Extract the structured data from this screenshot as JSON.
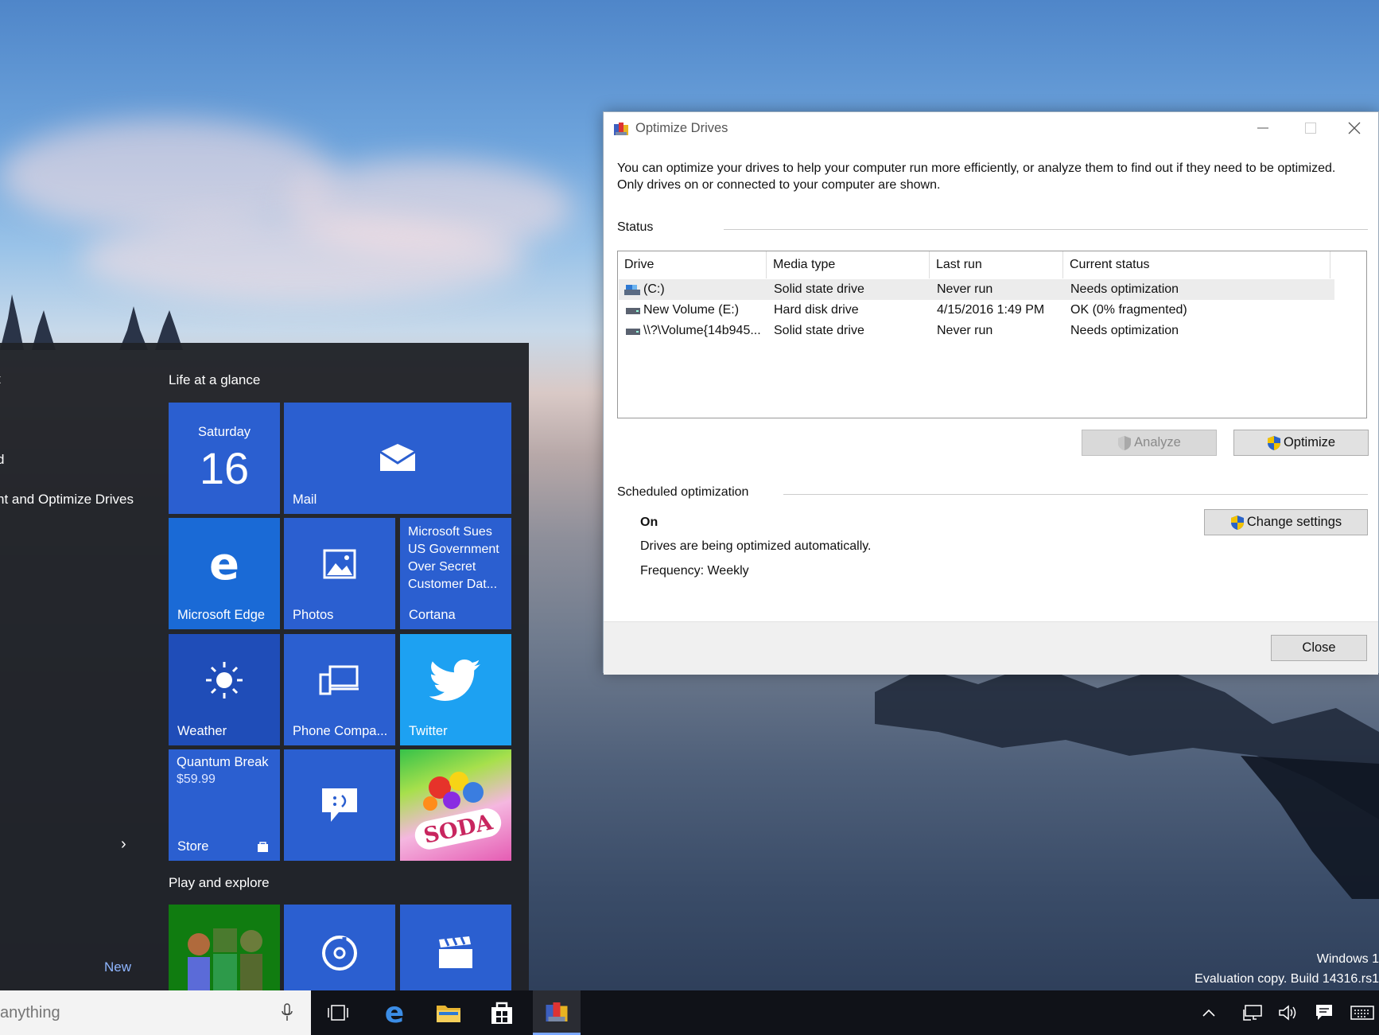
{
  "desktop": {
    "watermark_line1": "Windows 1",
    "watermark_line2": "Evaluation copy. Build 14316.rs1"
  },
  "start_menu": {
    "left_items": [
      "t",
      "d",
      "nt and Optimize Drives"
    ],
    "expand_label": "›",
    "new_label": "New",
    "group1_title": "Life at a glance",
    "group2_title": "Play and explore",
    "tiles": {
      "calendar_day": "Saturday",
      "calendar_date": "16",
      "mail": "Mail",
      "edge": "Microsoft Edge",
      "photos": "Photos",
      "cortana_news": "Microsoft Sues US Government Over Secret Customer Dat...",
      "cortana": "Cortana",
      "weather": "Weather",
      "phone": "Phone Compa...",
      "twitter": "Twitter",
      "store_title": "Quantum Break",
      "store_price": "$59.99",
      "store": "Store",
      "candy": "SODA"
    }
  },
  "dialog": {
    "title": "Optimize Drives",
    "description": "You can optimize your drives to help your computer run more efficiently, or analyze them to find out if they need to be optimized. Only drives on or connected to your computer are shown.",
    "status_label": "Status",
    "columns": [
      "Drive",
      "Media type",
      "Last run",
      "Current status"
    ],
    "drives": [
      {
        "drive": "(C:)",
        "media": "Solid state drive",
        "last_run": "Never run",
        "status": "Needs optimization"
      },
      {
        "drive": "New Volume (E:)",
        "media": "Hard disk drive",
        "last_run": "4/15/2016 1:49 PM",
        "status": "OK (0% fragmented)"
      },
      {
        "drive": "\\\\?\\Volume{14b945...",
        "media": "Solid state drive",
        "last_run": "Never run",
        "status": "Needs optimization"
      }
    ],
    "analyze_label": "Analyze",
    "optimize_label": "Optimize",
    "scheduled_label": "Scheduled optimization",
    "sched_state": "On",
    "sched_desc": "Drives are being optimized automatically.",
    "sched_freq": "Frequency: Weekly",
    "change_settings_label": "Change settings",
    "close_label": "Close"
  },
  "taskbar": {
    "search_placeholder": "anything"
  },
  "colors": {
    "tile_blue": "#2b5fd0",
    "tile_blue_dark": "#1f4db8",
    "edge_blue": "#1a6ad6",
    "twitter_blue": "#1da1f2",
    "xbox_green": "#107c10",
    "shield_blue": "#2a63c8",
    "shield_yellow": "#f2c200"
  }
}
